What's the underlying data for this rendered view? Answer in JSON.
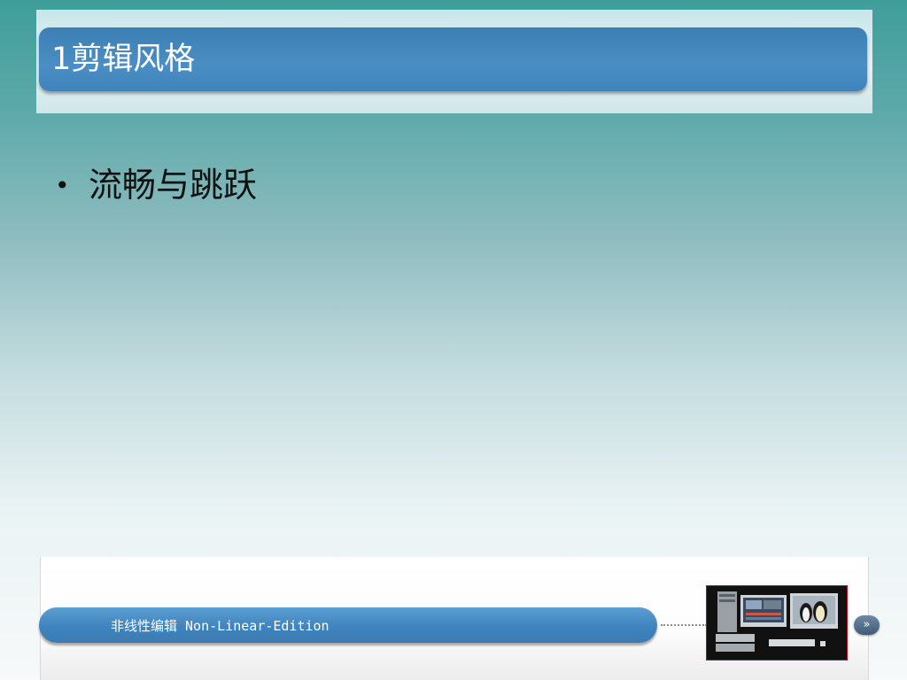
{
  "slide": {
    "title": "1剪辑风格",
    "bullets": [
      {
        "marker": "•",
        "text": "流畅与跳跃"
      }
    ]
  },
  "footer": {
    "label": "非线性编辑 Non-Linear-Edition",
    "next_button_label": "»",
    "thumbnail_icon": "editing-workstation-image"
  },
  "colors": {
    "title_bar": "#3f83bc",
    "footer_bar": "#4a8ec4",
    "thumbnail_border": "#c0121a",
    "background_top": "#3f9e9a",
    "background_bottom": "#f7f9fa"
  }
}
